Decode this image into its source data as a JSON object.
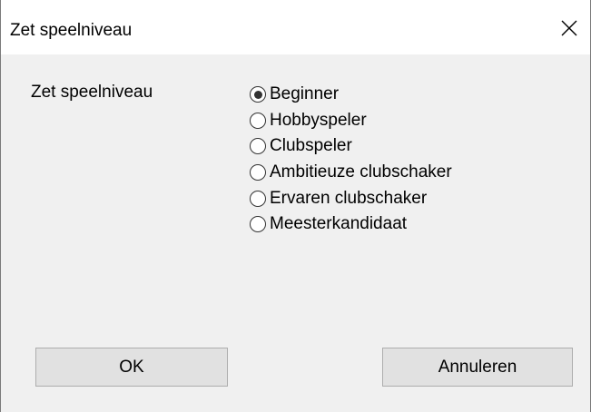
{
  "dialog": {
    "title": "Zet speelniveau",
    "close_icon": "close-icon"
  },
  "form": {
    "group_label": "Zet speelniveau",
    "options": [
      {
        "label": "Beginner",
        "checked": true
      },
      {
        "label": "Hobbyspeler",
        "checked": false
      },
      {
        "label": "Clubspeler",
        "checked": false
      },
      {
        "label": "Ambitieuze clubschaker",
        "checked": false
      },
      {
        "label": "Ervaren clubschaker",
        "checked": false
      },
      {
        "label": "Meesterkandidaat",
        "checked": false
      }
    ]
  },
  "buttons": {
    "ok_label": "OK",
    "cancel_label": "Annuleren"
  }
}
